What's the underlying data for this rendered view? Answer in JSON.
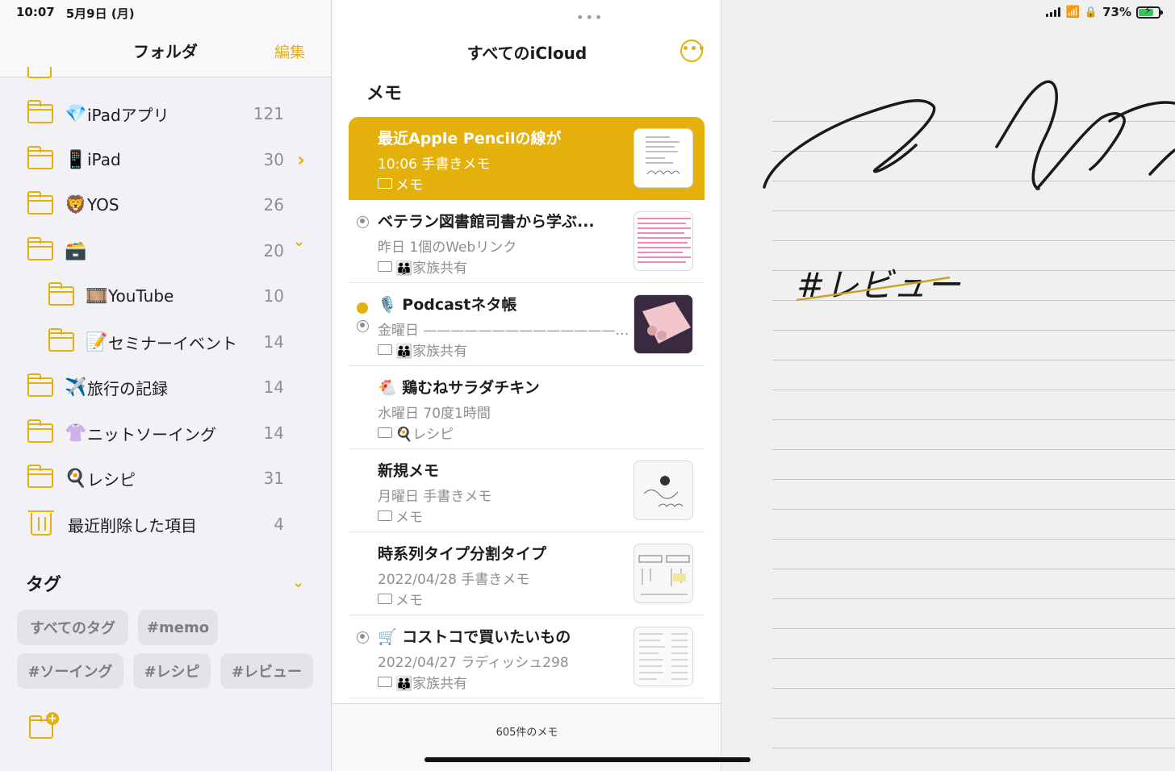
{
  "status_bar": {
    "time": "10:07",
    "date": "5月9日 (月)",
    "battery": "73%"
  },
  "sidebar": {
    "title": "フォルダ",
    "edit_label": "編集",
    "folders": [
      {
        "emoji": "💎",
        "name": "iPadアプリ",
        "count": "121"
      },
      {
        "emoji": "📱",
        "name": "iPad",
        "count": "30",
        "chevron": "›"
      },
      {
        "emoji": "🦁",
        "name": "YOS",
        "count": "26"
      },
      {
        "emoji": "🗃️",
        "name": "",
        "count": "20",
        "chevron": "⌄"
      },
      {
        "emoji": "🎞️",
        "name": "YouTube",
        "count": "10"
      },
      {
        "emoji": "📝",
        "name": "セミナーイベント",
        "count": "14"
      },
      {
        "emoji": "✈️",
        "name": "旅行の記録",
        "count": "14"
      },
      {
        "emoji": "👚",
        "name": "ニットソーイング",
        "count": "14"
      },
      {
        "emoji": "🍳",
        "name": "レシピ",
        "count": "31"
      },
      {
        "emoji": "",
        "name": "最近削除した項目",
        "count": "4"
      }
    ],
    "tags_title": "タグ",
    "tags_chevron": "⌄",
    "tags": [
      "すべてのタグ",
      "#memo",
      "#ソーイング",
      "#レシピ",
      "#レビュー"
    ]
  },
  "list": {
    "title": "すべてのiCloud",
    "grabber": "•••",
    "more": "•••",
    "section": "メモ",
    "notes": [
      {
        "title": "最近Apple Pencilの線が",
        "meta": "10:06  手書きメモ",
        "folder": "メモ"
      },
      {
        "title": "ベテラン図書館司書から学ぶ...",
        "meta": "昨日  1個のWebリンク",
        "folder": "👪家族共有"
      },
      {
        "title": "🎙️ Podcastネタ帳",
        "meta": "金曜日 ——————————————…",
        "folder": "👪家族共有"
      },
      {
        "title": "🐔 鶏むねサラダチキン",
        "meta": "水曜日  70度1時間",
        "folder": "🍳レシピ"
      },
      {
        "title": "新規メモ",
        "meta": "月曜日  手書きメモ",
        "folder": "メモ"
      },
      {
        "title": "時系列タイプ分割タイプ",
        "meta": "2022/04/28  手書きメモ",
        "folder": "メモ"
      },
      {
        "title": "🛒 コストコで買いたいもの",
        "meta": "2022/04/27  ラディッシュ298",
        "folder": "👪家族共有"
      }
    ],
    "count_text": "605件のメモ"
  },
  "editor": {
    "handwriting_text": "#レビュー"
  },
  "colors": {
    "accent": "#e3b00c",
    "background": "#f2f2f6"
  }
}
